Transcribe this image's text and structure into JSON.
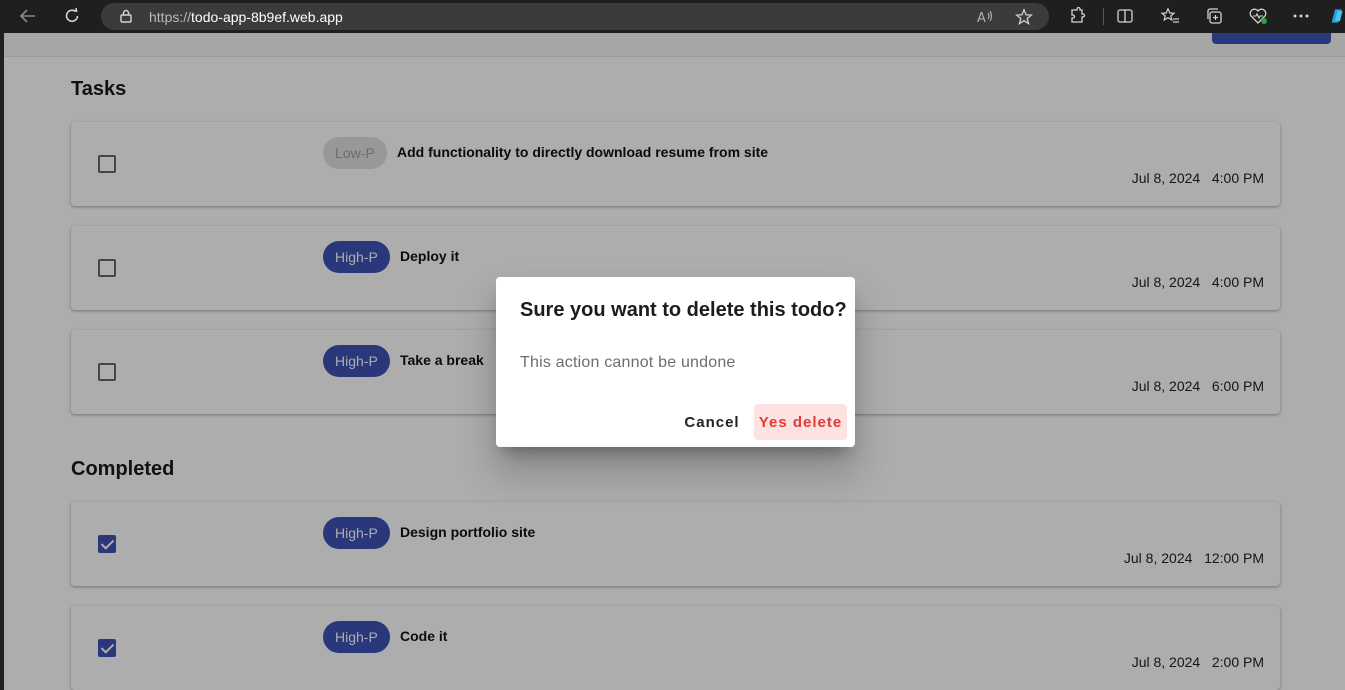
{
  "browser": {
    "url_protocol": "https://",
    "url_host": "todo-app-8b9ef.web.app"
  },
  "sections": {
    "tasks_title": "Tasks",
    "completed_title": "Completed"
  },
  "tasks": [
    {
      "priority": "Low-P",
      "title": "Add functionality to directly download resume from site",
      "date": "Jul 8, 2024",
      "time": "4:00 PM",
      "done": false
    },
    {
      "priority": "High-P",
      "title": "Deploy it",
      "date": "Jul 8, 2024",
      "time": "4:00 PM",
      "done": false
    },
    {
      "priority": "High-P",
      "title": "Take a break",
      "date": "Jul 8, 2024",
      "time": "6:00 PM",
      "done": false
    }
  ],
  "completed": [
    {
      "priority": "High-P",
      "title": "Design portfolio site",
      "date": "Jul 8, 2024",
      "time": "12:00 PM",
      "done": true
    },
    {
      "priority": "High-P",
      "title": "Code it",
      "date": "Jul 8, 2024",
      "time": "2:00 PM",
      "done": true
    }
  ],
  "dialog": {
    "title": "Sure you want to delete this todo?",
    "message": "This action cannot be undone",
    "cancel_label": "Cancel",
    "confirm_label": "Yes delete"
  },
  "colors": {
    "primary": "#3f51b5",
    "danger": "#e53935",
    "danger_bg": "#fde2e2"
  }
}
